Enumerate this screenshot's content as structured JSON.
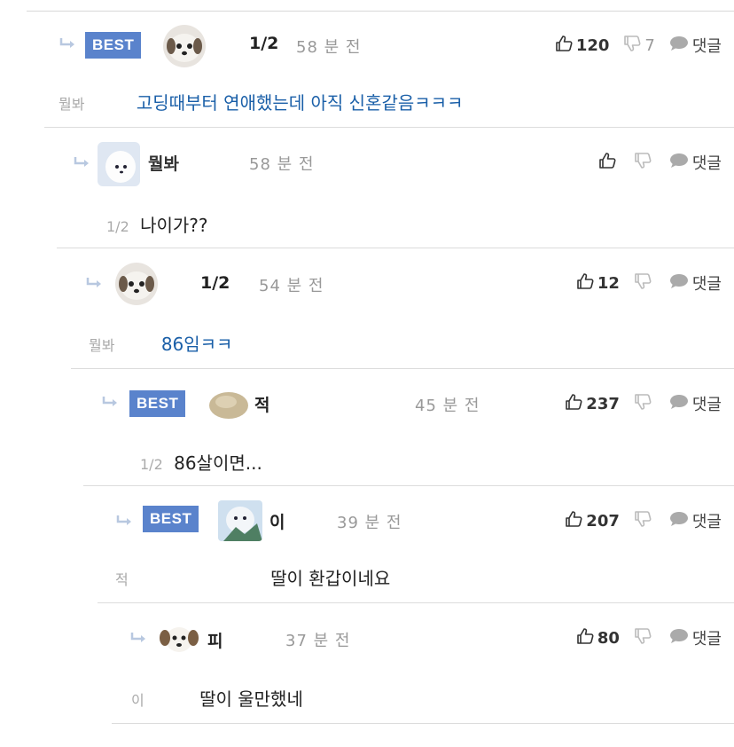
{
  "comments": [
    {
      "best_label": "BEST",
      "author": "1/2",
      "time": "58 분 전",
      "likes": "120",
      "dislikes": "7",
      "reply_label": "댓글",
      "mention": "뭘봐",
      "text": "고딩때부터 연애했는데 아직 신혼같음ㅋㅋㅋ"
    },
    {
      "author": "뭘봐",
      "time": "58 분 전",
      "likes": "",
      "dislikes": "",
      "reply_label": "댓글",
      "mention": "1/2",
      "text": "나이가??"
    },
    {
      "author": "1/2",
      "time": "54 분 전",
      "likes": "12",
      "dislikes": "",
      "reply_label": "댓글",
      "mention": "뭘봐",
      "text": "86임ㅋㅋ"
    },
    {
      "best_label": "BEST",
      "author": "적",
      "time": "45 분 전",
      "likes": "237",
      "dislikes": "",
      "reply_label": "댓글",
      "mention": "1/2",
      "text": "86살이면..."
    },
    {
      "best_label": "BEST",
      "author": "이",
      "time": "39 분 전",
      "likes": "207",
      "dislikes": "",
      "reply_label": "댓글",
      "mention": "적",
      "text": "딸이 환갑이네요"
    },
    {
      "author": "피",
      "time": "37 분 전",
      "likes": "80",
      "dislikes": "",
      "reply_label": "댓글",
      "mention": "이",
      "text": "딸이 울만했네"
    }
  ],
  "colors": {
    "best_badge": "#5a83cc",
    "link_text": "#1a5fa8",
    "muted": "#999999"
  }
}
